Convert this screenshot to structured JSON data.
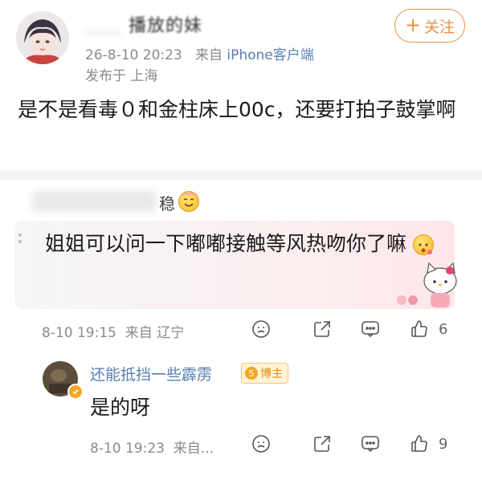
{
  "post": {
    "username_visible": "播放的妹",
    "date": "26-8-10 20:23",
    "via": "来自",
    "source": "iPhone客户端",
    "location": "发布于 上海",
    "follow_label": "关注",
    "text": "是不是看毒０和金柱床上00c，还要打拍子鼓掌啊"
  },
  "reply_to": {
    "name_tail": "稳"
  },
  "quoted_comment": {
    "text": "姐姐可以问一下嘟嘟接触等风热吻你了嘛",
    "date": "8-10 19:15",
    "location": "来自 辽宁",
    "like_count": "6"
  },
  "sub_reply": {
    "username": "还能抵挡一些霹雳",
    "badge": "博主",
    "text": "是的呀",
    "date": "8-10 19:23",
    "location": "来自...",
    "like_count": "9"
  },
  "icons": [
    "emoji-icon",
    "share-icon",
    "comment-icon",
    "like-icon",
    "plus-icon"
  ],
  "colors": {
    "accent": "#e8934a",
    "link": "#5a7fb0",
    "meta": "#8a8a8a"
  }
}
